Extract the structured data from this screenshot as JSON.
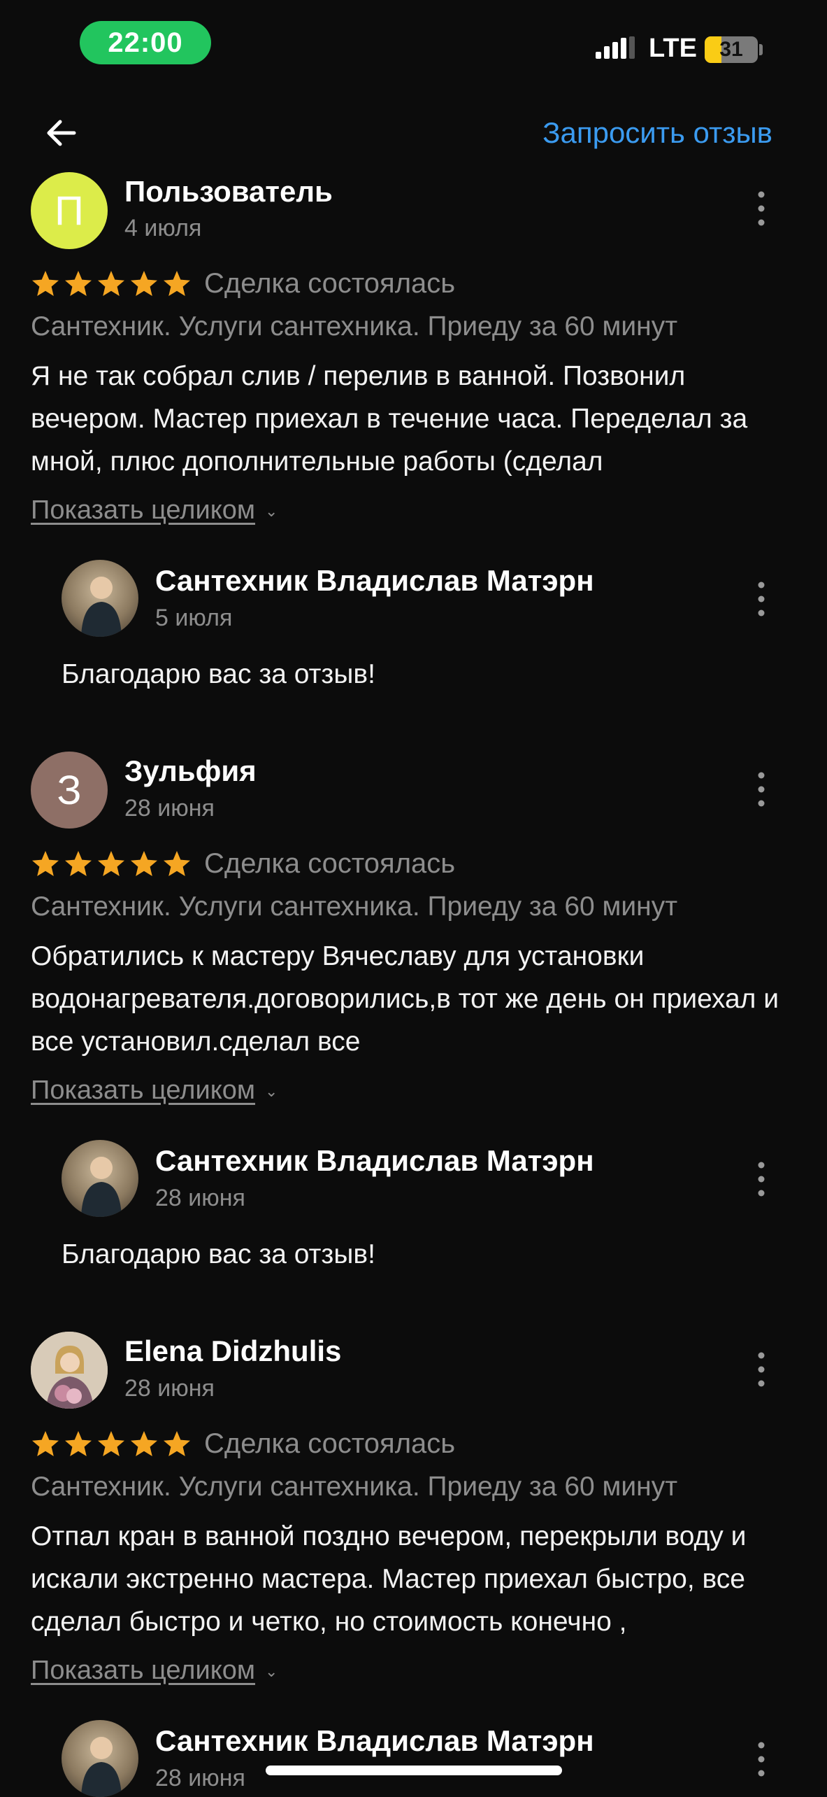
{
  "status_bar": {
    "time": "22:00",
    "network": "LTE",
    "battery": "31",
    "battery_level_percent": 31,
    "time_pill_color": "#22c55e",
    "battery_color": "#facc15"
  },
  "header": {
    "back_icon": "arrow-left-icon",
    "request_review_label": "Запросить отзыв",
    "link_color": "#3b9bf0"
  },
  "reviews": [
    {
      "author": "Пользователь",
      "avatar_letter": "П",
      "avatar_color": "#dcec4a",
      "date": "4 июля",
      "rating": 5,
      "deal_status": "Сделка состоялась",
      "service": "Сантехник. Услуги сантехника. Приеду за 60 минут",
      "text": "Я не так собрал слив / перелив в ванной. Позвонил вечером. Мастер приехал в течение часа. Переделал за мной, плюс дополнительные работы (сделал",
      "show_full_label": "Показать целиком",
      "reply": {
        "author": "Сантехник Владислав Матэрн",
        "date": "5 июля",
        "text": "Благодарю вас за отзыв!"
      }
    },
    {
      "author": "Зульфия",
      "avatar_letter": "З",
      "avatar_color": "#8e6f66",
      "date": "28 июня",
      "rating": 5,
      "deal_status": "Сделка состоялась",
      "service": "Сантехник. Услуги сантехника. Приеду за 60 минут",
      "text": "Обратились к  мастеру Вячеславу для установки водонагревателя.договорились,в тот же день он приехал и все установил.сделал все",
      "show_full_label": "Показать целиком",
      "reply": {
        "author": "Сантехник Владислав Матэрн",
        "date": "28 июня",
        "text": "Благодарю вас за отзыв!"
      }
    },
    {
      "author": "Elena Didzhulis",
      "avatar_letter": "",
      "avatar_color": "#d8cbb8",
      "date": "28 июня",
      "rating": 5,
      "deal_status": "Сделка состоялась",
      "service": "Сантехник. Услуги сантехника. Приеду за 60 минут",
      "text": "Отпал кран в ванной поздно вечером, перекрыли воду и искали экстренно мастера. Мастер приехал быстро, все сделал быстро и четко, но стоимость конечно ,",
      "show_full_label": "Показать целиком",
      "reply": {
        "author": "Сантехник Владислав Матэрн",
        "date": "28 июня",
        "text": ""
      }
    }
  ],
  "star_color": "#f5a623",
  "menu_icon": "more-vertical-icon"
}
